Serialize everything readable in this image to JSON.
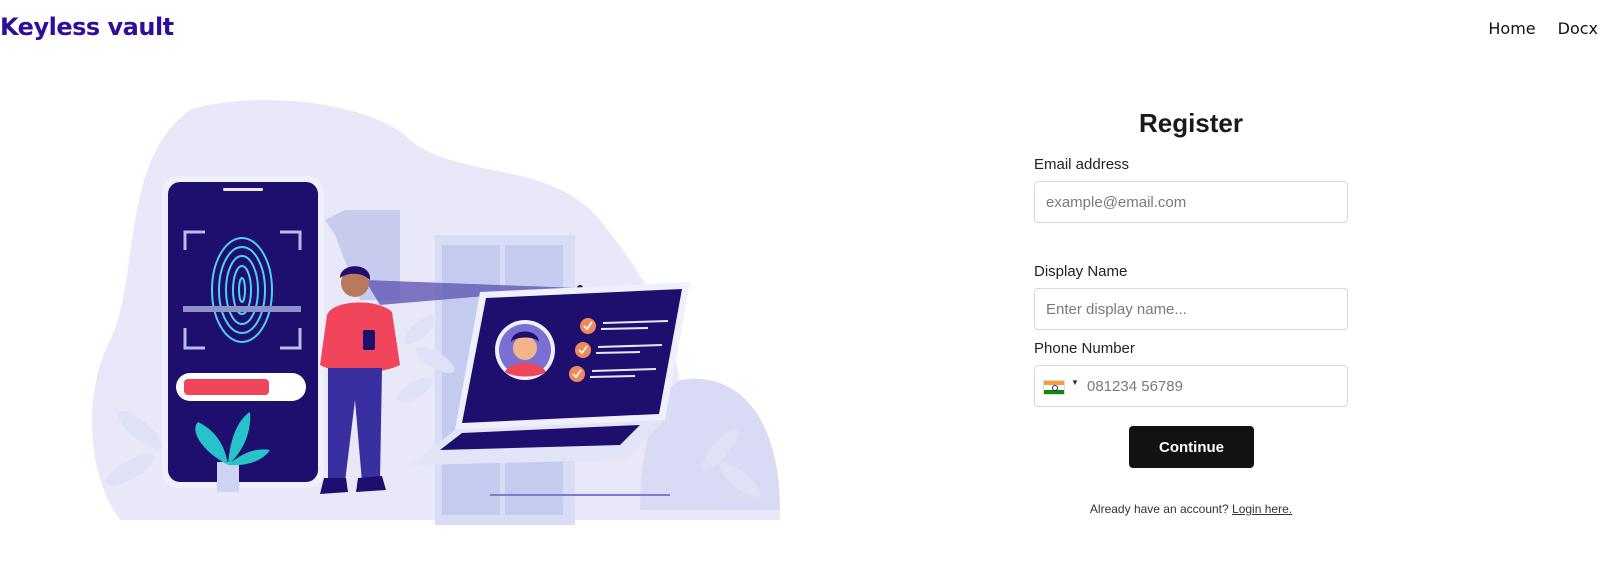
{
  "navbar": {
    "brand": "Keyless vault",
    "links": [
      "Home",
      "Docx"
    ]
  },
  "register": {
    "title": "Register",
    "email_label": "Email address",
    "email_placeholder": "example@email.com",
    "display_name_label": "Display Name",
    "display_name_placeholder": "Enter display name...",
    "phone_label": "Phone Number",
    "phone_country": "in",
    "phone_placeholder": "081234 56789",
    "continue_label": "Continue",
    "login_prompt": "Already have an account?",
    "login_link": "Login here."
  },
  "colors": {
    "brand": "#2f0f9a",
    "button": "#121212",
    "illustration_dark": "#1e0f6e",
    "illustration_accent": "#f0455a"
  },
  "icons": {
    "flag": "india-flag-icon",
    "caret": "caret-down-icon"
  }
}
